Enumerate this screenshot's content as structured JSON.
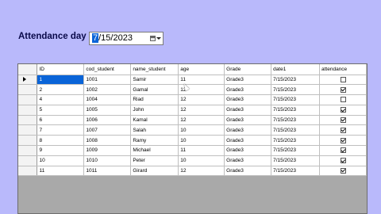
{
  "form": {
    "attendance_label": "Attendance day",
    "date_first_char": "7",
    "date_rest": "/15/2023"
  },
  "grid": {
    "columns": [
      "ID",
      "cod_student",
      "name_student",
      "age",
      "Grade",
      "date1",
      "attendance"
    ],
    "rows": [
      {
        "id": "1",
        "cod": "1001",
        "name": "Samir",
        "age": "11",
        "grade": "Grade3",
        "date": "7/15/2023",
        "attendance": false
      },
      {
        "id": "2",
        "cod": "1002",
        "name": "Gamal",
        "age": "12",
        "grade": "Grade3",
        "date": "7/15/2023",
        "attendance": true
      },
      {
        "id": "4",
        "cod": "1004",
        "name": "Riad",
        "age": "12",
        "grade": "Grade3",
        "date": "7/15/2023",
        "attendance": false
      },
      {
        "id": "5",
        "cod": "1005",
        "name": "John",
        "age": "12",
        "grade": "Grade3",
        "date": "7/15/2023",
        "attendance": true
      },
      {
        "id": "6",
        "cod": "1006",
        "name": "Kamal",
        "age": "12",
        "grade": "Grade3",
        "date": "7/15/2023",
        "attendance": true
      },
      {
        "id": "7",
        "cod": "1007",
        "name": "Salah",
        "age": "10",
        "grade": "Grade3",
        "date": "7/15/2023",
        "attendance": true
      },
      {
        "id": "8",
        "cod": "1008",
        "name": "Ramy",
        "age": "10",
        "grade": "Grade3",
        "date": "7/15/2023",
        "attendance": true
      },
      {
        "id": "9",
        "cod": "1009",
        "name": "Michael",
        "age": "11",
        "grade": "Grade3",
        "date": "7/15/2023",
        "attendance": true
      },
      {
        "id": "10",
        "cod": "1010",
        "name": "Peter",
        "age": "10",
        "grade": "Grade3",
        "date": "7/15/2023",
        "attendance": true
      },
      {
        "id": "11",
        "cod": "1011",
        "name": "Girard",
        "age": "12",
        "grade": "Grade3",
        "date": "7/15/2023",
        "attendance": true
      }
    ]
  }
}
